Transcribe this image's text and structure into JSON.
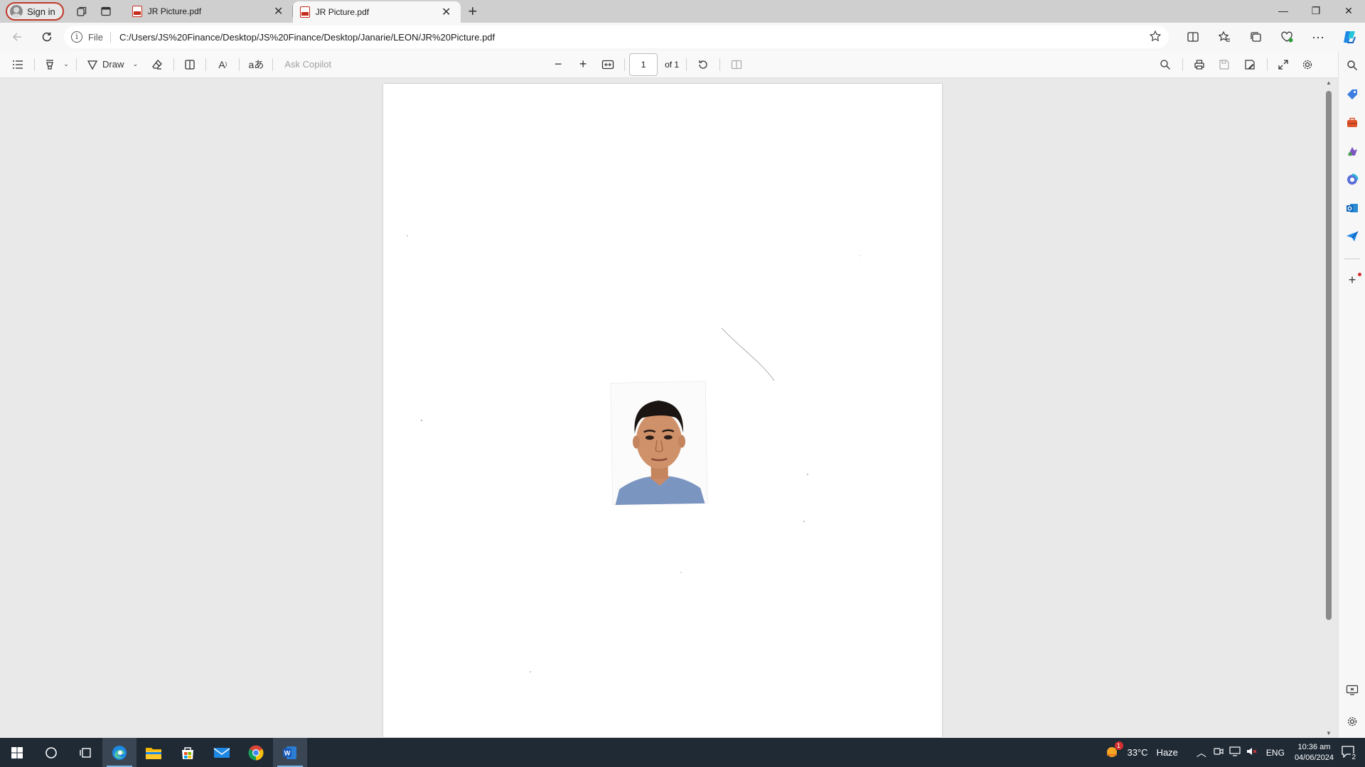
{
  "window": {
    "profile_label": "Sign in",
    "tabs": [
      {
        "label": "JR Picture.pdf",
        "active": false
      },
      {
        "label": "JR Picture.pdf",
        "active": true
      }
    ]
  },
  "addressbar": {
    "scheme": "File",
    "url": "C:/Users/JS%20Finance/Desktop/JS%20Finance/Desktop/Janarie/LEON/JR%20Picture.pdf"
  },
  "pdf_toolbar": {
    "draw_label": "Draw",
    "ask_placeholder": "Ask Copilot",
    "page_current": "1",
    "page_total_label": "of 1"
  },
  "taskbar": {
    "weather_temp": "33°C",
    "weather_desc": "Haze",
    "weather_badge": "1",
    "language": "ENG",
    "time": "10:36 am",
    "date": "04/06/2024",
    "notification_count": "2"
  },
  "colors": {
    "accent": "#0078d4",
    "edge_blue": "#1e88e5",
    "profile_border": "#c0392b",
    "pdf_red": "#c42b1c"
  }
}
